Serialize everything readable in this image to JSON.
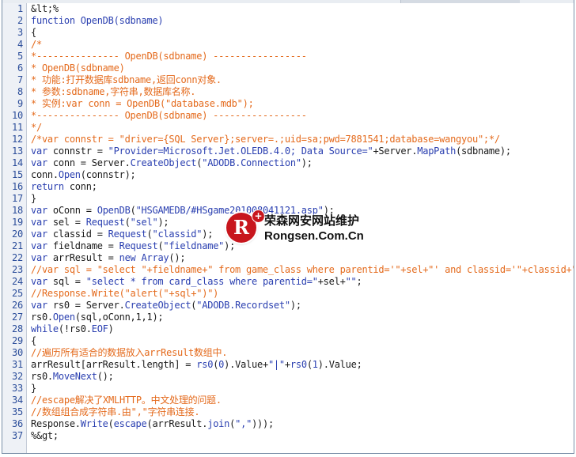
{
  "editor": {
    "lines": [
      {
        "n": "1",
        "text": "&lt;%",
        "kind": "plain"
      },
      {
        "n": "2",
        "text": "function OpenDB(sdbname)",
        "kind": "keyword"
      },
      {
        "n": "3",
        "text": "{",
        "kind": "plain"
      },
      {
        "n": "4",
        "text": "/*",
        "kind": "comment"
      },
      {
        "n": "5",
        "text": "*--------------- OpenDB(sdbname) -----------------",
        "kind": "comment"
      },
      {
        "n": "6",
        "text": "* OpenDB(sdbname)",
        "kind": "comment"
      },
      {
        "n": "7",
        "text": "* 功能:打开数据库sdbname,返回conn对象.",
        "kind": "comment"
      },
      {
        "n": "8",
        "text": "* 参数:sdbname,字符串,数据库名称.",
        "kind": "comment"
      },
      {
        "n": "9",
        "text": "* 实例:var conn = OpenDB(\"database.mdb\");",
        "kind": "comment"
      },
      {
        "n": "10",
        "text": "*--------------- OpenDB(sdbname) -----------------",
        "kind": "comment"
      },
      {
        "n": "11",
        "text": "*/",
        "kind": "comment"
      },
      {
        "n": "12",
        "text": "/*var connstr = \"driver={SQL Server};server=.;uid=sa;pwd=7881541;database=wangyou\";*/",
        "kind": "comment"
      },
      {
        "n": "13",
        "text": "var connstr = \"Provider=Microsoft.Jet.OLEDB.4.0; Data Source=\"+Server.MapPath(sdbname);",
        "kind": "mixed"
      },
      {
        "n": "14",
        "text": "var conn = Server.CreateObject(\"ADODB.Connection\");",
        "kind": "mixed"
      },
      {
        "n": "15",
        "text": "conn.Open(connstr);",
        "kind": "mixed"
      },
      {
        "n": "16",
        "text": "return conn;",
        "kind": "mixed"
      },
      {
        "n": "17",
        "text": "}",
        "kind": "plain"
      },
      {
        "n": "18",
        "text": "var oConn = OpenDB(\"HSGAMEDB/#HSgame201008041121.asp\");",
        "kind": "mixed"
      },
      {
        "n": "19",
        "text": "var sel = Request(\"sel\");",
        "kind": "mixed"
      },
      {
        "n": "20",
        "text": "var classid = Request(\"classid\");",
        "kind": "mixed"
      },
      {
        "n": "21",
        "text": "var fieldname = Request(\"fieldname\");",
        "kind": "mixed"
      },
      {
        "n": "22",
        "text": "var arrResult = new Array();",
        "kind": "mixed"
      },
      {
        "n": "23",
        "text": "//var sql = \"select \"+fieldname+\" from game_class where parentid='\"+sel+\"' and classid='\"+classid+\"'\";",
        "kind": "comment"
      },
      {
        "n": "24",
        "text": "var sql = \"select * from card_class where parentid=\"+sel+\"\";",
        "kind": "mixed"
      },
      {
        "n": "25",
        "text": "//Response.Write(\"alert(\"+sql+\")\")",
        "kind": "comment"
      },
      {
        "n": "26",
        "text": "var rs0 = Server.CreateObject(\"ADODB.Recordset\");",
        "kind": "mixed"
      },
      {
        "n": "27",
        "text": "rs0.Open(sql,oConn,1,1);",
        "kind": "mixed"
      },
      {
        "n": "28",
        "text": "while(!rs0.EOF)",
        "kind": "mixed"
      },
      {
        "n": "29",
        "text": "{",
        "kind": "plain"
      },
      {
        "n": "30",
        "text": "//遍历所有适合的数据放入arrResult数组中.",
        "kind": "comment"
      },
      {
        "n": "31",
        "text": "arrResult[arrResult.length] = rs0(0).Value+\"|\"+rs0(1).Value;",
        "kind": "mixed"
      },
      {
        "n": "32",
        "text": "rs0.MoveNext();",
        "kind": "mixed"
      },
      {
        "n": "33",
        "text": "}",
        "kind": "plain"
      },
      {
        "n": "34",
        "text": "//escape解决了XMLHTTP。中文处理的问题.",
        "kind": "comment"
      },
      {
        "n": "35",
        "text": "//数组组合成字符串.由\",\"字符串连接.",
        "kind": "comment"
      },
      {
        "n": "36",
        "text": "Response.Write(escape(arrResult.join(\",\")));",
        "kind": "mixed"
      },
      {
        "n": "37",
        "text": "%&gt;",
        "kind": "plain"
      }
    ]
  },
  "watermark": {
    "logo_letter": "R",
    "plus": "+",
    "name_cn": "荣森网安网站维护",
    "name_en": "Rongsen.Com.Cn"
  },
  "colors": {
    "comment": "#e46a1c",
    "keyword": "#2a3fb0",
    "plain": "#1a1a1a",
    "line_number": "#2b4d9a",
    "gutter": "#eef1f6",
    "logo": "#c8161d"
  },
  "icons": {
    "watermark_logo": "rongsen-logo-icon"
  }
}
